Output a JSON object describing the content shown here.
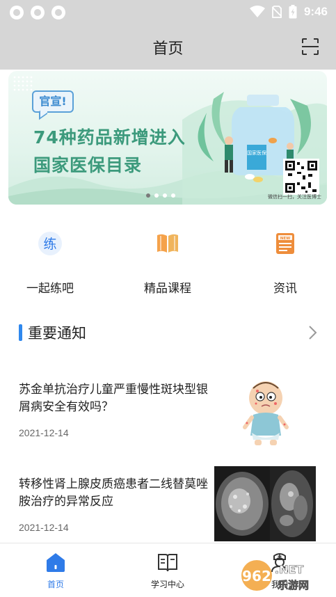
{
  "status_bar": {
    "time": "9:46"
  },
  "header": {
    "title": "首页",
    "scan_icon": "scan-icon"
  },
  "banner": {
    "tag": "官宣!",
    "line1": "74种药品新增进入",
    "line2": "国家医保目录",
    "caption": "微信扫一扫，关注医博士",
    "bottle_label": "国家医保",
    "slides": 4,
    "active_slide": 1
  },
  "quick_menu": [
    {
      "label": "一起练吧",
      "icon": "practice-icon",
      "glyph": "练"
    },
    {
      "label": "精品课程",
      "icon": "book-icon"
    },
    {
      "label": "资讯",
      "icon": "news-icon",
      "badge": "NEW"
    }
  ],
  "notices": {
    "title": "重要通知",
    "more_icon": "chevron-right-icon",
    "items": [
      {
        "title": "苏金单抗治疗儿童严重慢性斑块型银屑病安全有效吗？",
        "date": "2021-12-14"
      },
      {
        "title": "转移性肾上腺皮质癌患者二线替莫唑胺治疗的异常反应",
        "date": "2021-12-14"
      }
    ]
  },
  "bottom_nav": [
    {
      "label": "首页",
      "icon": "home-icon",
      "active": true
    },
    {
      "label": "学习中心",
      "icon": "study-center-icon",
      "active": false
    },
    {
      "label": "我的",
      "icon": "doctor-profile-icon",
      "active": false
    }
  ],
  "watermark": {
    "text1": "962",
    "text2": ".NET",
    "text3": "乐游网"
  },
  "colors": {
    "accent": "#2f88ee",
    "banner_text": "#3c9a7c",
    "orange": "#f09a3e",
    "status_bar": "#d6d6d6"
  }
}
